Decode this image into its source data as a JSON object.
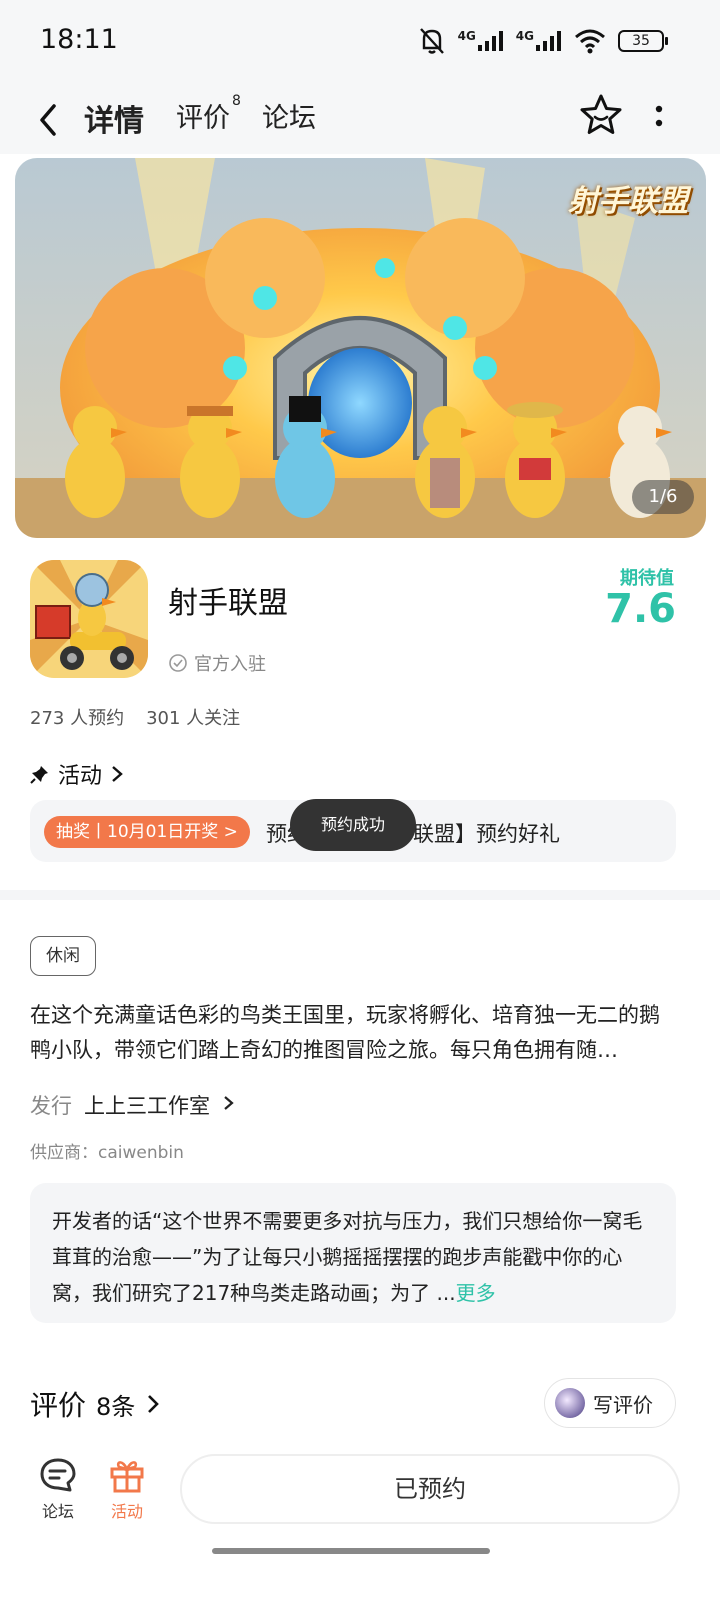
{
  "status_bar": {
    "time": "18:11",
    "battery": "35"
  },
  "header": {
    "tabs": [
      {
        "label": "详情"
      },
      {
        "label": "评价",
        "badge": "8"
      },
      {
        "label": "论坛"
      }
    ]
  },
  "banner": {
    "logo_text": "射手联盟",
    "counter": "1/6"
  },
  "app": {
    "name": "射手联盟",
    "official_label": "官方入驻",
    "expect_label": "期待值",
    "expect_score": "7.6",
    "reservations": "273 人预约",
    "followers": "301 人关注"
  },
  "activity": {
    "title": "活动",
    "lottery_badge": "抽奖丨10月01日开奖 >",
    "text": "预约抽奖【射手联盟】预约好礼"
  },
  "toast": "预约成功",
  "details": {
    "tag": "休闲",
    "description": "在这个充满童话色彩的鸟类王国里，玩家将孵化、培育独一无二的鹅鸭小队，带领它们踏上奇幻的推图冒险之旅。每只角色拥有随…",
    "publisher_label": "发行",
    "publisher_value": "上上三工作室",
    "supplier": "供应商：caiwenbin"
  },
  "developer_note": {
    "text": "开发者的话“这个世界不需要更多对抗与压力，我们只想给你一窝毛茸茸的治愈——”为了让每只小鹅摇摇摆摆的跑步声能戳中你的心窝，我们研究了217种鸟类走路动画；为了 ...",
    "more": "更多"
  },
  "reviews": {
    "title": "评价",
    "count": "8条",
    "write_label": "写评价"
  },
  "bottom_nav": {
    "forum_label": "论坛",
    "activity_label": "活动",
    "reserved_label": "已预约"
  },
  "colors": {
    "accent": "#35cbb3",
    "orange": "#f2784a"
  }
}
